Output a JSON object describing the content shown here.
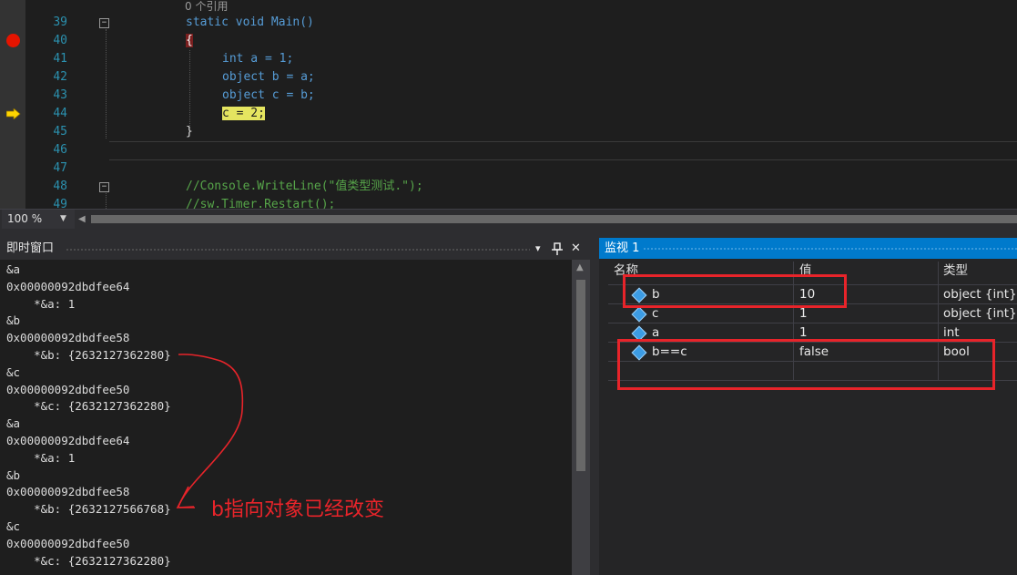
{
  "editor": {
    "reference_hint": "0 个引用",
    "lines": [
      {
        "num": "39",
        "code": "static void Main()"
      },
      {
        "num": "40",
        "code": "{"
      },
      {
        "num": "41",
        "code": "int a = 1;"
      },
      {
        "num": "42",
        "code": "object b = a;"
      },
      {
        "num": "43",
        "code": "object c = b;"
      },
      {
        "num": "44",
        "code": "c = 2;"
      },
      {
        "num": "45",
        "code": "}"
      },
      {
        "num": "46",
        "code": ""
      },
      {
        "num": "47",
        "code": ""
      },
      {
        "num": "48",
        "code": "//Console.WriteLine(\"值类型测试.\");"
      },
      {
        "num": "49",
        "code": "//sw.Timer.Restart();"
      }
    ],
    "zoom": "100 %"
  },
  "immediate": {
    "title": "即时窗口",
    "pin_glyph": "T",
    "dropdown_glyph": "▾",
    "close_glyph": "✕",
    "lines": [
      "&a",
      "0x00000092dbdfee64",
      "    *&a: 1",
      "&b",
      "0x00000092dbdfee58",
      "    *&b: {2632127362280}",
      "&c",
      "0x00000092dbdfee50",
      "    *&c: {2632127362280}",
      "&a",
      "0x00000092dbdfee64",
      "    *&a: 1",
      "&b",
      "0x00000092dbdfee58",
      "    *&b: {2632127566768}",
      "&c",
      "0x00000092dbdfee50",
      "    *&c: {2632127362280}"
    ]
  },
  "watch": {
    "title": "监视 1",
    "headers": {
      "name": "名称",
      "value": "值",
      "type": "类型"
    },
    "rows": [
      {
        "name": "b",
        "value": "10",
        "type": "object {int}"
      },
      {
        "name": "c",
        "value": "1",
        "type": "object {int}"
      },
      {
        "name": "a",
        "value": "1",
        "type": "int"
      },
      {
        "name": "b==c",
        "value": "false",
        "type": "bool"
      }
    ]
  },
  "annotation": {
    "text": "b指向对象已经改变",
    "color": "#e8242a"
  }
}
